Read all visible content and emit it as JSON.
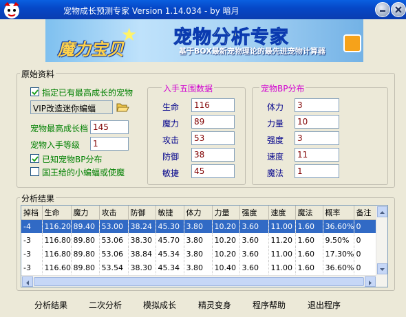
{
  "window": {
    "title": "宠物成长预测专家 Version 1.14.034 - by 暗月"
  },
  "banner": {
    "logo_text": "魔力宝贝",
    "heading": "宠物分析专家",
    "slogan": "基于BOX最新宠物理论的最先进宠物计算器"
  },
  "source_group": {
    "label": "原始资料",
    "chk_has_max_pet": {
      "label": "指定已有最高成长的宠物",
      "checked": true
    },
    "vip_pet_value": "VIP改造迷你蝙蝠",
    "max_grade_label": "宠物最高成长档",
    "max_grade_value": "145",
    "level_label": "宠物入手等级",
    "level_value": "1",
    "chk_know_bp": {
      "label": "已知宠物BP分布",
      "checked": true
    },
    "chk_king_bat": {
      "label": "国王给的小蝙蝠或使魔",
      "checked": false
    }
  },
  "stats_group": {
    "label": "入手五围数据",
    "rows": [
      {
        "label": "生命",
        "value": "116"
      },
      {
        "label": "魔力",
        "value": "89"
      },
      {
        "label": "攻击",
        "value": "53"
      },
      {
        "label": "防御",
        "value": "38"
      },
      {
        "label": "敏捷",
        "value": "45"
      }
    ]
  },
  "bp_group": {
    "label": "宠物BP分布",
    "rows": [
      {
        "label": "体力",
        "value": "3"
      },
      {
        "label": "力量",
        "value": "10"
      },
      {
        "label": "强度",
        "value": "3"
      },
      {
        "label": "速度",
        "value": "11"
      },
      {
        "label": "魔法",
        "value": "1"
      }
    ]
  },
  "results": {
    "label": "分析结果",
    "columns": [
      "掉档",
      "生命",
      "魔力",
      "攻击",
      "防御",
      "敏捷",
      "体力",
      "力量",
      "强度",
      "速度",
      "魔法",
      "概率",
      "备注"
    ],
    "rows": [
      [
        "-4",
        "116.20",
        "89.40",
        "53.00",
        "38.24",
        "45.30",
        "3.80",
        "10.20",
        "3.60",
        "11.00",
        "1.60",
        "36.60%",
        "0"
      ],
      [
        "-3",
        "116.80",
        "89.80",
        "53.06",
        "38.30",
        "45.70",
        "3.80",
        "10.20",
        "3.60",
        "11.20",
        "1.60",
        "9.50%",
        "0"
      ],
      [
        "-3",
        "116.80",
        "89.80",
        "53.06",
        "38.84",
        "45.34",
        "3.80",
        "10.20",
        "3.60",
        "11.00",
        "1.60",
        "17.30%",
        "0"
      ],
      [
        "-3",
        "116.60",
        "89.80",
        "53.54",
        "38.30",
        "45.34",
        "3.80",
        "10.40",
        "3.60",
        "11.00",
        "1.60",
        "36.60%",
        "0"
      ]
    ],
    "selected_row": 0
  },
  "actions": {
    "analyze": "分析结果",
    "secondary": "二次分析",
    "simulate": "模拟成长",
    "transform": "精灵变身",
    "help": "程序帮助",
    "exit": "退出程序"
  },
  "colors": {
    "titlebar": "#0a4fd0",
    "selection": "#316ac5",
    "value_text": "#800000",
    "label_text": "#008000",
    "label_blue": "#00008b",
    "sub_label": "#d000d0"
  }
}
